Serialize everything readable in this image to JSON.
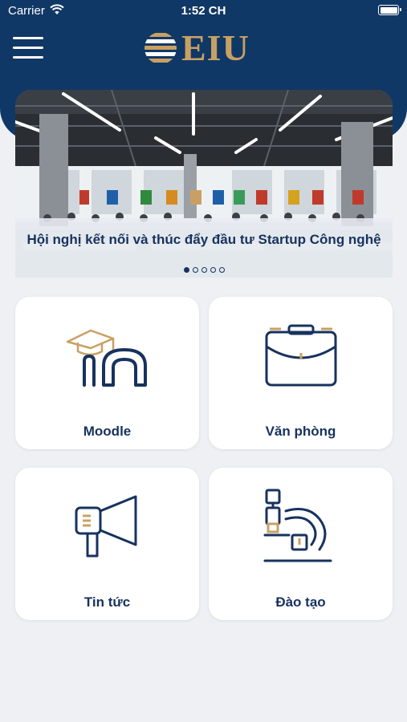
{
  "status_bar": {
    "carrier": "Carrier",
    "time": "1:52 CH"
  },
  "header": {
    "logo_text": "EIU"
  },
  "banner": {
    "title": "Hội nghị kết nối và thúc đẩy đầu tư Startup Công nghệ",
    "slide_count": 5,
    "active_index": 0
  },
  "tiles": [
    {
      "label": "Moodle",
      "icon": "moodle-icon"
    },
    {
      "label": "Văn phòng",
      "icon": "briefcase-icon"
    },
    {
      "label": "Tin tức",
      "icon": "megaphone-icon"
    },
    {
      "label": "Đào tạo",
      "icon": "microscope-icon"
    }
  ],
  "colors": {
    "navy": "#103866",
    "gold": "#c9a063",
    "text": "#17325e",
    "background": "#eef0f4"
  }
}
